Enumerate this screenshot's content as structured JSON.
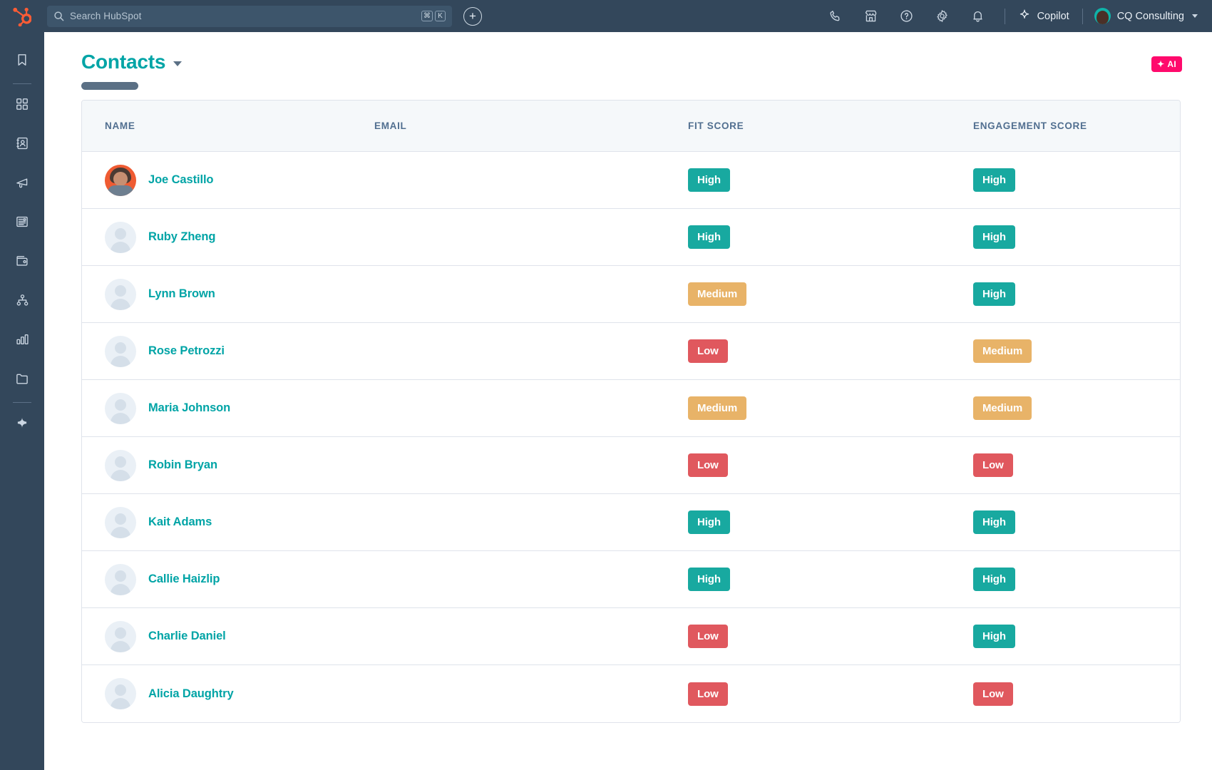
{
  "topnav": {
    "logo": "hubspot-sprocket-logo",
    "search": {
      "placeholder": "Search HubSpot",
      "kbd": [
        "⌘",
        "K"
      ],
      "icon": "search-icon"
    },
    "add_button": "+",
    "icons": [
      {
        "name": "phone-icon",
        "label": "Calling"
      },
      {
        "name": "marketplace-icon",
        "label": "Marketplace"
      },
      {
        "name": "help-icon",
        "label": "Help"
      },
      {
        "name": "gear-icon",
        "label": "Settings"
      },
      {
        "name": "bell-icon",
        "label": "Notifications"
      }
    ],
    "copilot": {
      "label": "Copilot",
      "icon": "sparkle-icon"
    },
    "account": {
      "label": "CQ Consulting",
      "avatar": "user-avatar",
      "caret": "chevron-down-icon"
    }
  },
  "sidebar": {
    "items": [
      {
        "name": "bookmarks-icon",
        "label": "Bookmarks"
      },
      {
        "name": "workspaces-icon",
        "label": "Workspaces"
      },
      {
        "name": "contacts-icon",
        "label": "CRM"
      },
      {
        "name": "marketing-megaphone-icon",
        "label": "Marketing"
      },
      {
        "name": "content-icon",
        "label": "Content"
      },
      {
        "name": "commerce-wallet-icon",
        "label": "Commerce"
      },
      {
        "name": "automation-icon",
        "label": "Automations"
      },
      {
        "name": "reporting-bar-chart-icon",
        "label": "Reporting"
      },
      {
        "name": "library-folder-icon",
        "label": "Library"
      },
      {
        "name": "ai-sparkle-icon",
        "label": "AI"
      }
    ]
  },
  "page": {
    "title": "Contacts",
    "title_caret": "chevron-down-icon",
    "redacted_subtitle": "",
    "ai_badge": {
      "spark": "✦",
      "label": "AI"
    }
  },
  "table": {
    "columns": [
      "NAME",
      "EMAIL",
      "FIT SCORE",
      "ENGAGEMENT SCORE"
    ],
    "rows": [
      {
        "name": "Joe Castillo",
        "avatar": "photo",
        "email": "",
        "fit": "High",
        "engagement": "High"
      },
      {
        "name": "Ruby Zheng",
        "avatar": "placeholder",
        "email": "",
        "fit": "High",
        "engagement": "High"
      },
      {
        "name": "Lynn Brown",
        "avatar": "placeholder",
        "email": "",
        "fit": "Medium",
        "engagement": "High"
      },
      {
        "name": "Rose Petrozzi",
        "avatar": "placeholder",
        "email": "",
        "fit": "Low",
        "engagement": "Medium"
      },
      {
        "name": "Maria Johnson",
        "avatar": "placeholder",
        "email": "",
        "fit": "Medium",
        "engagement": "Medium"
      },
      {
        "name": "Robin Bryan",
        "avatar": "placeholder",
        "email": "",
        "fit": "Low",
        "engagement": "Low"
      },
      {
        "name": "Kait Adams",
        "avatar": "placeholder",
        "email": "",
        "fit": "High",
        "engagement": "High"
      },
      {
        "name": "Callie Haizlip",
        "avatar": "placeholder",
        "email": "",
        "fit": "High",
        "engagement": "High"
      },
      {
        "name": "Charlie Daniel",
        "avatar": "placeholder",
        "email": "",
        "fit": "Low",
        "engagement": "High"
      },
      {
        "name": "Alicia Daughtry",
        "avatar": "placeholder",
        "email": "",
        "fit": "Low",
        "engagement": "Low"
      }
    ]
  },
  "colors": {
    "nav_bg": "#33475b",
    "teal": "#00a4a6",
    "badge_high": "#18a9a0",
    "badge_medium": "#e8b368",
    "badge_low": "#e0585e",
    "ai_pink": "#ff0a6c",
    "header_bg": "#f5f8fa",
    "border": "#dfe3eb"
  }
}
